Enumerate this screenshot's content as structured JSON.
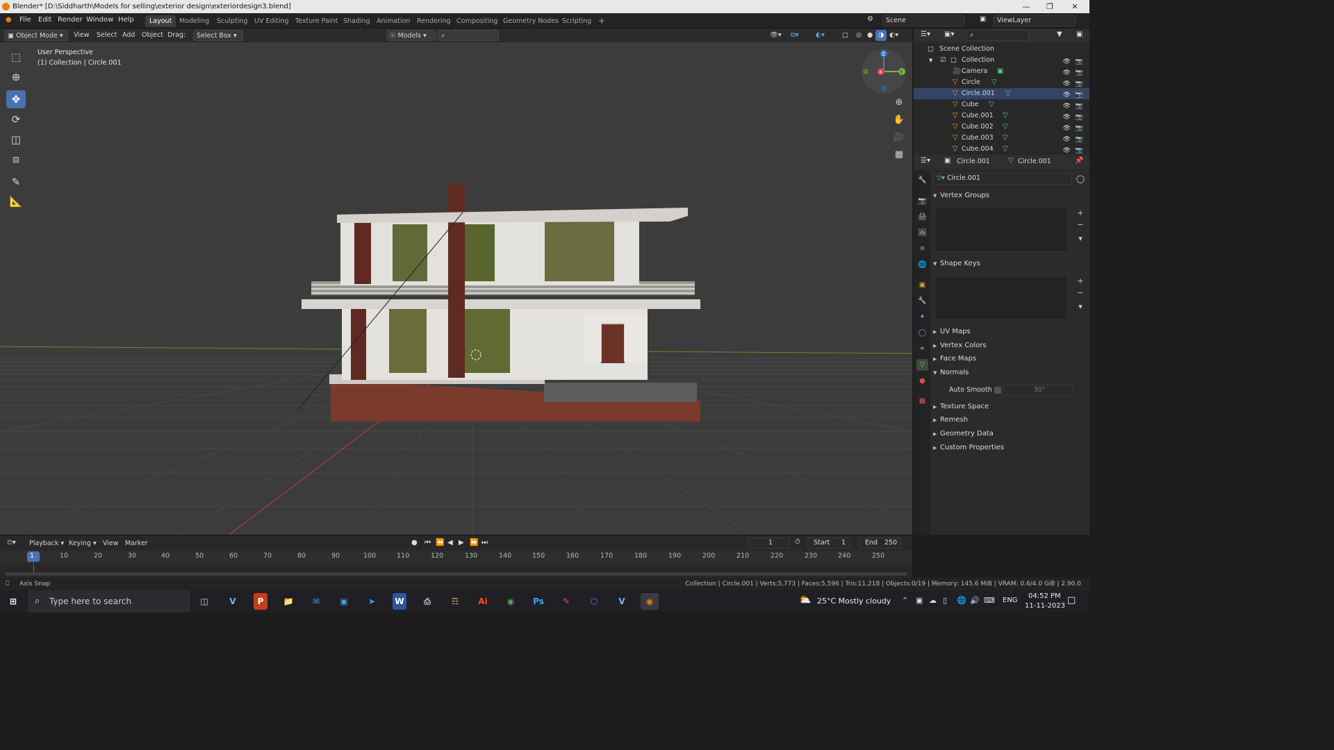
{
  "title_bar": {
    "title": "Blender* [D:\\Siddharth\\Models for selling\\exterior design\\exteriordesign3.blend]"
  },
  "menus": [
    "File",
    "Edit",
    "Render",
    "Window",
    "Help"
  ],
  "workspaces": [
    "Layout",
    "Modeling",
    "Sculpting",
    "UV Editing",
    "Texture Paint",
    "Shading",
    "Animation",
    "Rendering",
    "Compositing",
    "Geometry Nodes",
    "Scripting"
  ],
  "active_workspace": "Layout",
  "scene": {
    "label": "Scene",
    "view_layer": "ViewLayer"
  },
  "header_3d": {
    "mode": "Object Mode",
    "view": "View",
    "select": "Select",
    "add": "Add",
    "object": "Object",
    "drag_label": "Drag:",
    "drag_value": "Select Box",
    "orientation": "Models"
  },
  "viewport": {
    "line1": "User Perspective",
    "line2": "(1) Collection | Circle.001"
  },
  "outliner": {
    "scene_collection": "Scene Collection",
    "collection": "Collection",
    "items": [
      {
        "name": "Camera",
        "icon": "camera-icon"
      },
      {
        "name": "Circle",
        "icon": "mesh-icon"
      },
      {
        "name": "Circle.001",
        "icon": "mesh-icon"
      },
      {
        "name": "Cube",
        "icon": "mesh-icon"
      },
      {
        "name": "Cube.001",
        "icon": "mesh-icon"
      },
      {
        "name": "Cube.002",
        "icon": "mesh-icon"
      },
      {
        "name": "Cube.003",
        "icon": "mesh-icon"
      },
      {
        "name": "Cube.004",
        "icon": "mesh-icon"
      }
    ],
    "selected": "Circle.001"
  },
  "properties": {
    "breadcrumb_object": "Circle.001",
    "breadcrumb_data": "Circle.001",
    "datablock": "Circle.001",
    "panels": {
      "vertex_groups": "Vertex Groups",
      "shape_keys": "Shape Keys",
      "uv_maps": "UV Maps",
      "vertex_colors": "Vertex Colors",
      "face_maps": "Face Maps",
      "normals": "Normals",
      "auto_smooth": "Auto Smooth",
      "auto_smooth_angle": "30°",
      "texture_space": "Texture Space",
      "remesh": "Remesh",
      "geometry_data": "Geometry Data",
      "custom_properties": "Custom Properties"
    }
  },
  "timeline": {
    "playback": "Playback",
    "keying": "Keying",
    "view": "View",
    "marker": "Marker",
    "current_frame": "1",
    "start_label": "Start",
    "start": "1",
    "end_label": "End",
    "end": "250",
    "ruler": [
      "1",
      "10",
      "20",
      "30",
      "40",
      "50",
      "60",
      "70",
      "80",
      "90",
      "100",
      "110",
      "120",
      "130",
      "140",
      "150",
      "160",
      "170",
      "180",
      "190",
      "200",
      "210",
      "220",
      "230",
      "240",
      "250"
    ]
  },
  "status": {
    "left": "Axis Snap",
    "right": "Collection | Circle.001 | Verts:5,773 | Faces:5,596 | Tris:11,218 | Objects:0/19 | Memory: 145.6 MiB | VRAM: 0.6/4.0 GiB | 2.90.0"
  },
  "taskbar": {
    "search_placeholder": "Type here to search",
    "weather": "25°C  Mostly cloudy",
    "lang": "ENG",
    "time": "04:52 PM",
    "date": "11-11-2023"
  }
}
